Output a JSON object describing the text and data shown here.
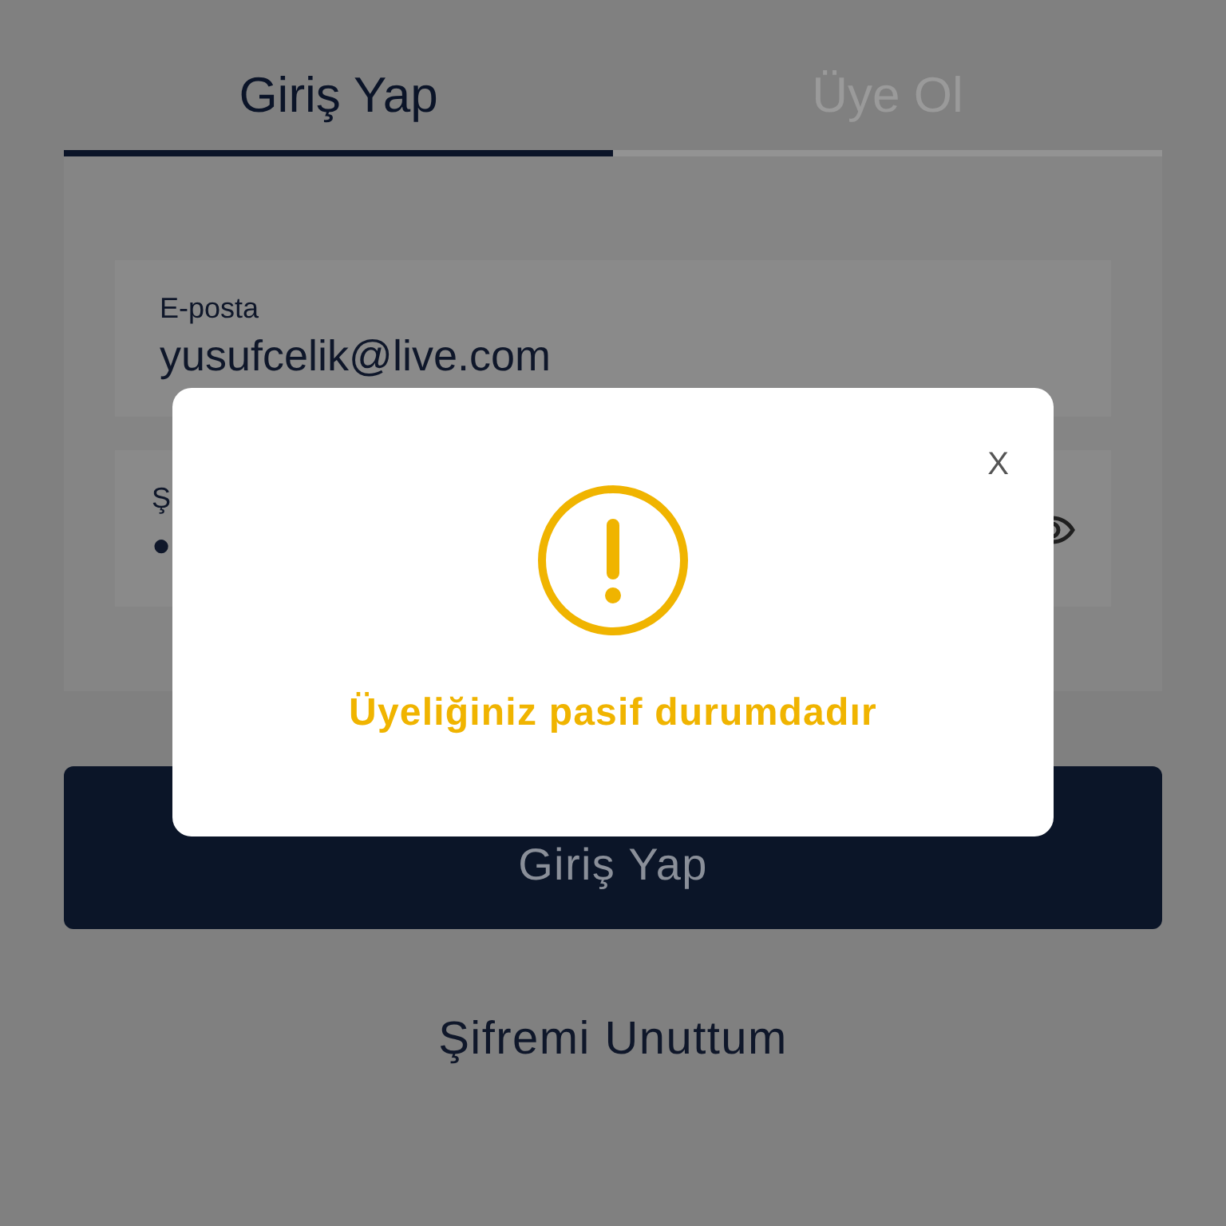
{
  "tabs": [
    {
      "label": "Giriş Yap",
      "selected": true
    },
    {
      "label": "Üye Ol",
      "selected": false
    }
  ],
  "fields": [
    {
      "kind": "text",
      "label": "E-posta",
      "value": "yusufcelik@live.com"
    },
    {
      "kind": "password",
      "label": "Ş",
      "value": "●"
    }
  ],
  "submit_button": "Giriş Yap",
  "forgot_link": "Şifremi Unuttum",
  "dialog": {
    "close": "X",
    "message": "Üyeliğiniz pasif durumdadır"
  }
}
